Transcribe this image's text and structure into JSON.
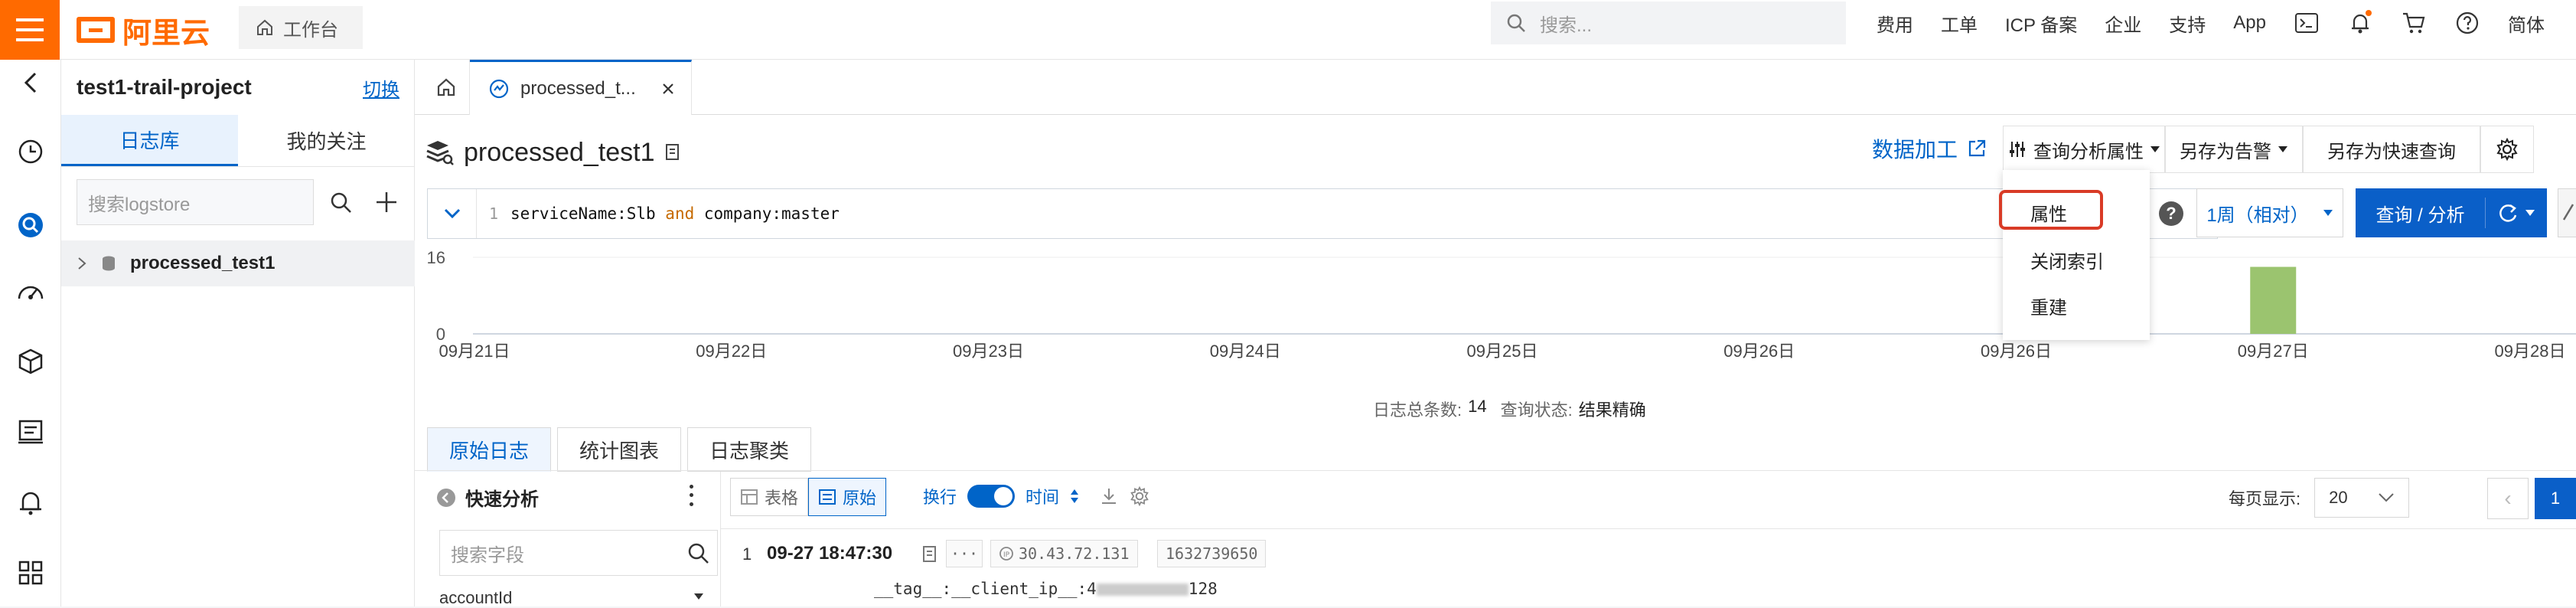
{
  "topbar": {
    "brand": "阿里云",
    "workbench": "工作台",
    "search_placeholder": "搜索...",
    "nav": [
      "费用",
      "工单",
      "ICP 备案",
      "企业",
      "支持",
      "App"
    ],
    "lang": "简体"
  },
  "project": {
    "name": "test1-trail-project",
    "switch": "切换",
    "tabs": [
      "日志库",
      "我的关注"
    ],
    "search_placeholder": "搜索logstore",
    "logstores": [
      "processed_test1"
    ]
  },
  "tab_bar": {
    "active_tab": "processed_t..."
  },
  "main": {
    "title": "processed_test1",
    "data_processing": "数据加工",
    "query_attr": "查询分析属性",
    "save_alert": "另存为告警",
    "save_quick": "另存为快速查询",
    "query_line_no": "1",
    "query": {
      "p1": "serviceName:Slb ",
      "and": "and",
      "p2": " company:master"
    },
    "time_range": "1周（相对）",
    "query_button": "查询 / 分析"
  },
  "dropdown": {
    "items": [
      "属性",
      "关闭索引",
      "重建"
    ],
    "highlighted": "属性"
  },
  "chart_data": {
    "type": "bar",
    "categories": [
      "09月21日",
      "09月22日",
      "09月23日",
      "09月24日",
      "09月25日",
      "09月26日",
      "09月26日",
      "09月27日",
      "09月28日"
    ],
    "y_ticks": [
      "16",
      "0"
    ],
    "ylim": [
      0,
      16
    ],
    "bars": [
      {
        "x": "09月27日",
        "value": 14
      }
    ],
    "bar_color": "#9bc46f"
  },
  "histogram_summary": {
    "count_label": "日志总条数:",
    "count": "14",
    "status_label": "查询状态:",
    "status": "结果精确"
  },
  "result_tabs": [
    "原始日志",
    "统计图表",
    "日志聚类"
  ],
  "quick_analysis": {
    "title": "快速分析",
    "search_placeholder": "搜索字段",
    "first_field": "accountId"
  },
  "toolbar": {
    "table": "表格",
    "raw": "原始",
    "wrap": "换行",
    "time": "时间",
    "per_page_label": "每页显示:",
    "per_page": "20",
    "page": "1"
  },
  "log": {
    "index": "1",
    "time": "09-27 18:47:30",
    "ip": "30.43.72.131",
    "ts": "1632739650",
    "line2_prefix": "__tag__:__client_ip__:4",
    "line2_suffix": "128"
  },
  "colors": {
    "brand": "#ff6a00",
    "primary": "#0064c8",
    "highlight": "#d93b26"
  }
}
